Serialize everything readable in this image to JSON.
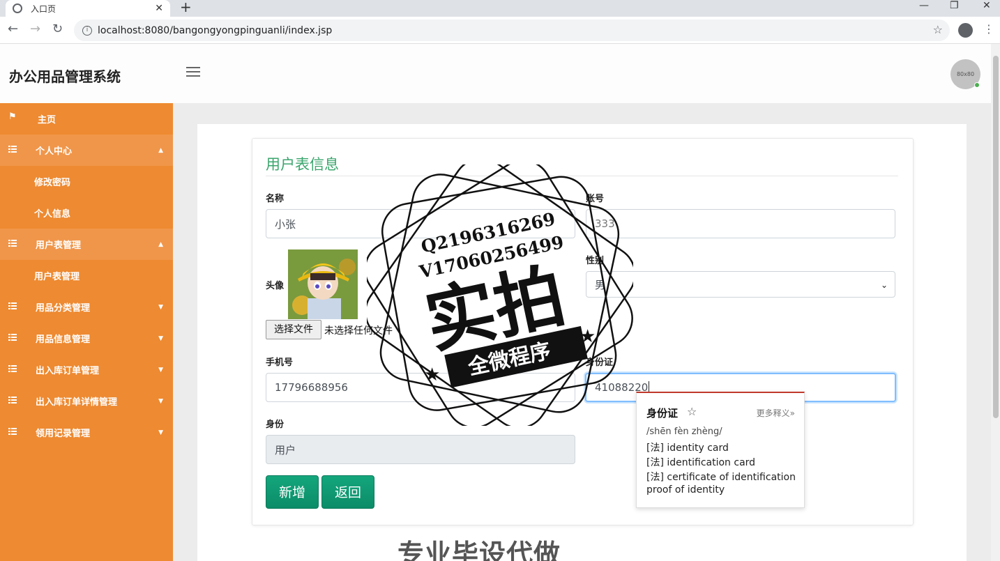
{
  "browser": {
    "tab_title": "入口页",
    "tab_close": "✕",
    "new_tab": "+",
    "url": "localhost:8080/bangongyongpinguanli/index.jsp",
    "win_min": "—",
    "win_restore": "❐",
    "win_close": "✕"
  },
  "header": {
    "title": "办公用品管理系统",
    "avatar_text": "80x80"
  },
  "sidebar": {
    "items": [
      {
        "label": "主页",
        "icon": "flag-icon"
      },
      {
        "label": "个人中心",
        "icon": "grid-icon",
        "caret": "▲"
      },
      {
        "label": "修改密码"
      },
      {
        "label": "个人信息"
      },
      {
        "label": "用户表管理",
        "icon": "grid-icon",
        "caret": "▲"
      },
      {
        "label": "用户表管理"
      },
      {
        "label": "用品分类管理",
        "icon": "grid-icon",
        "caret": "▼"
      },
      {
        "label": "用品信息管理",
        "icon": "grid-icon",
        "caret": "▼"
      },
      {
        "label": "出入库订单管理",
        "icon": "grid-icon",
        "caret": "▼"
      },
      {
        "label": "出入库订单详情管理",
        "icon": "grid-icon",
        "caret": "▼"
      },
      {
        "label": "领用记录管理",
        "icon": "grid-icon",
        "caret": "▼"
      }
    ]
  },
  "form": {
    "title": "用户表信息",
    "name_label": "名称",
    "name_value": "小张",
    "account_label": "账号",
    "account_value": "333",
    "avatar_label": "头像",
    "file_button": "选择文件",
    "file_status": "未选择任何文件",
    "gender_label": "性别",
    "gender_value": "男",
    "phone_label": "手机号",
    "phone_value": "17796688956",
    "idcard_label": "身份证",
    "idcard_value": "41088220",
    "role_label": "身份",
    "role_value": "用户",
    "add_button": "新增",
    "back_button": "返回"
  },
  "dictionary": {
    "word": "身份证",
    "more": "更多释义»",
    "pinyin": "/shēn fèn zhèng/",
    "definitions": [
      "[法] identity card",
      "[法] identification card",
      "[法] certificate of identification",
      "proof of identity"
    ]
  },
  "watermark": {
    "line1": "Q2196316269",
    "line2": "V17060256499",
    "big": "实拍",
    "banner": "全微程序",
    "bottom": "专业毕设代做"
  },
  "colors": {
    "sidebar": "#ee8a31",
    "accent_green": "#3aa56d",
    "button_green": "#0e9b73"
  }
}
